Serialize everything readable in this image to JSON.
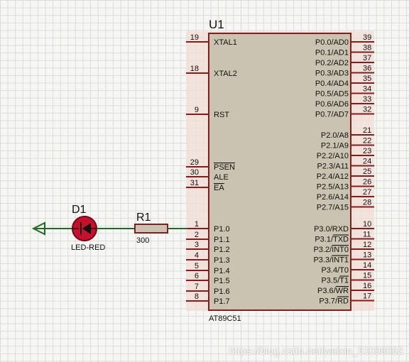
{
  "colors": {
    "pin": "#8b1a1a",
    "body_fill": "#cbc3b1",
    "body_stroke": "#8b1a1a",
    "highlight": "#f1dcd6",
    "wire": "#1f6b1f",
    "led_fill": "#c8102e",
    "text": "#111111"
  },
  "chip": {
    "ref": "U1",
    "part": "AT89C51",
    "left_pins": [
      {
        "num": "19",
        "name": "XTAL1",
        "over": false
      },
      {
        "num": "18",
        "name": "XTAL2",
        "over": false
      },
      {
        "num": "9",
        "name": "RST",
        "over": false
      },
      {
        "num": "29",
        "name": "PSEN",
        "over": true
      },
      {
        "num": "30",
        "name": "ALE",
        "over": false
      },
      {
        "num": "31",
        "name": "EA",
        "over": true
      },
      {
        "num": "1",
        "name": "P1.0",
        "over": false
      },
      {
        "num": "2",
        "name": "P1.1",
        "over": false
      },
      {
        "num": "3",
        "name": "P1.2",
        "over": false
      },
      {
        "num": "4",
        "name": "P1.3",
        "over": false
      },
      {
        "num": "5",
        "name": "P1.4",
        "over": false
      },
      {
        "num": "6",
        "name": "P1.5",
        "over": false
      },
      {
        "num": "7",
        "name": "P1.6",
        "over": false
      },
      {
        "num": "8",
        "name": "P1.7",
        "over": false
      }
    ],
    "right_pins": [
      {
        "num": "39",
        "name": "P0.0/AD0",
        "over": ""
      },
      {
        "num": "38",
        "name": "P0.1/AD1",
        "over": ""
      },
      {
        "num": "37",
        "name": "P0.2/AD2",
        "over": ""
      },
      {
        "num": "36",
        "name": "P0.3/AD3",
        "over": ""
      },
      {
        "num": "35",
        "name": "P0.4/AD4",
        "over": ""
      },
      {
        "num": "34",
        "name": "P0.5/AD5",
        "over": ""
      },
      {
        "num": "33",
        "name": "P0.6/AD6",
        "over": ""
      },
      {
        "num": "32",
        "name": "P0.7/AD7",
        "over": ""
      },
      {
        "num": "21",
        "name": "P2.0/A8",
        "over": ""
      },
      {
        "num": "22",
        "name": "P2.1/A9",
        "over": ""
      },
      {
        "num": "23",
        "name": "P2.2/A10",
        "over": ""
      },
      {
        "num": "24",
        "name": "P2.3/A11",
        "over": ""
      },
      {
        "num": "25",
        "name": "P2.4/A12",
        "over": ""
      },
      {
        "num": "26",
        "name": "P2.5/A13",
        "over": ""
      },
      {
        "num": "27",
        "name": "P2.6/A14",
        "over": ""
      },
      {
        "num": "28",
        "name": "P2.7/A15",
        "over": ""
      },
      {
        "num": "10",
        "name": "P3.0/RXD",
        "over": ""
      },
      {
        "num": "11",
        "name": "P3.1/TXD",
        "over": "TXD"
      },
      {
        "num": "12",
        "name": "P3.2/INT0",
        "over": "INT0"
      },
      {
        "num": "13",
        "name": "P3.3/INT1",
        "over": "INT1"
      },
      {
        "num": "14",
        "name": "P3.4/T0",
        "over": ""
      },
      {
        "num": "15",
        "name": "P3.5/T1",
        "over": "T1"
      },
      {
        "num": "16",
        "name": "P3.6/WR",
        "over": "WR"
      },
      {
        "num": "17",
        "name": "P3.7/RD",
        "over": "RD"
      }
    ]
  },
  "led": {
    "ref": "D1",
    "part": "LED-RED"
  },
  "resistor": {
    "ref": "R1",
    "value": "300"
  },
  "watermark": "https://blog.csdn.net/weixin_51098062"
}
